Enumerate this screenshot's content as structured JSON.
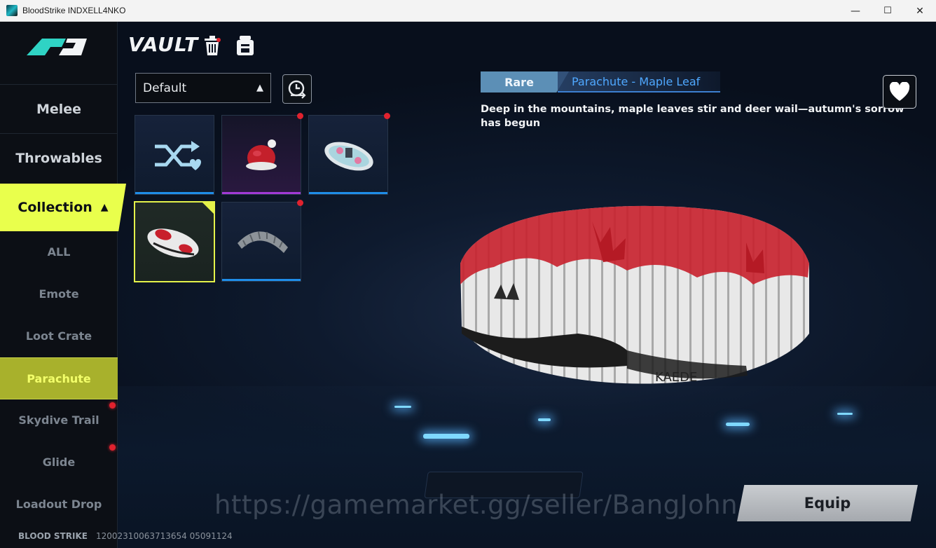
{
  "window": {
    "title": "BloodStrike INDXELL4NKO",
    "minimize": "—",
    "maximize": "☐",
    "close": "✕"
  },
  "sidebar": {
    "main_items": [
      {
        "label": "Melee"
      },
      {
        "label": "Throwables"
      }
    ],
    "collection": {
      "label": "Collection",
      "arrow": "▲"
    },
    "sub_items": [
      {
        "label": "ALL",
        "has_badge": false
      },
      {
        "label": "Emote",
        "has_badge": false
      },
      {
        "label": "Loot Crate",
        "has_badge": false
      },
      {
        "label": "Parachute",
        "has_badge": false,
        "selected": true
      },
      {
        "label": "Skydive Trail",
        "has_badge": true
      },
      {
        "label": "Glide",
        "has_badge": true
      },
      {
        "label": "Loadout Drop",
        "has_badge": false
      }
    ],
    "footer_brand": "BLOOD STRIKE",
    "footer_id": "12002310063713654 05091124"
  },
  "vault": {
    "title": "VAULT",
    "dropdown_value": "Default",
    "dropdown_caret": "▲"
  },
  "items": [
    {
      "name": "random",
      "rarity": "blue",
      "badge": false
    },
    {
      "name": "santa-hat",
      "rarity": "purple",
      "badge": true
    },
    {
      "name": "decorated-parachute",
      "rarity": "blue",
      "badge": true
    },
    {
      "name": "maple-leaf-parachute",
      "rarity": "selected",
      "badge": false
    },
    {
      "name": "grey-parachute",
      "rarity": "blue",
      "badge": true
    }
  ],
  "detail": {
    "rarity": "Rare",
    "item_name": "Parachute - Maple Leaf",
    "description": "Deep in the mountains, maple leaves stir and deer wail—autumn's sorrow has begun",
    "preview_text": "KAEDE"
  },
  "watermark": "https://gamemarket.gg/seller/BangJohn",
  "equip_label": "Equip",
  "colors": {
    "accent_yellow": "#e9ff4c",
    "rare_blue": "#5c8fb6",
    "name_blue": "#4fa8ff",
    "badge_red": "#e0222e"
  }
}
